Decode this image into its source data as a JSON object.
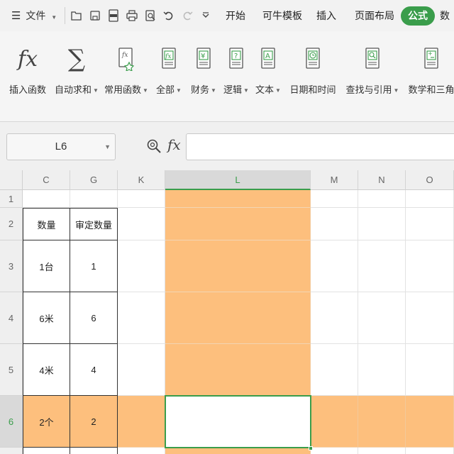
{
  "menubar": {
    "file_menu": "文件",
    "tabs": [
      "开始",
      "可牛模板",
      "插入",
      "页面布局",
      "公式",
      "数"
    ],
    "active_tab_index": 4
  },
  "ribbon": {
    "buttons": [
      {
        "label": "插入函数",
        "icon": "fx-icon",
        "dropdown": false
      },
      {
        "label": "自动求和",
        "icon": "sigma-icon",
        "dropdown": true
      },
      {
        "label": "常用函数",
        "icon": "common-function-icon",
        "dropdown": true
      },
      {
        "label": "全部",
        "icon": "all-functions-icon",
        "dropdown": true
      },
      {
        "label": "财务",
        "icon": "finance-icon",
        "dropdown": true
      },
      {
        "label": "逻辑",
        "icon": "logic-icon",
        "dropdown": true
      },
      {
        "label": "文本",
        "icon": "text-function-icon",
        "dropdown": true
      },
      {
        "label": "日期和时间",
        "icon": "datetime-icon",
        "dropdown": true
      },
      {
        "label": "查找与引用",
        "icon": "lookup-icon",
        "dropdown": true
      },
      {
        "label": "数学和三角",
        "icon": "math-icon",
        "dropdown": true
      }
    ]
  },
  "formula_bar": {
    "name_box": "L6",
    "fx_label": "fx",
    "formula": ""
  },
  "sheet": {
    "columns": [
      "C",
      "G",
      "K",
      "L",
      "M",
      "N",
      "O"
    ],
    "selected_column": "L",
    "rows": [
      "1",
      "2",
      "3",
      "4",
      "5",
      "6"
    ],
    "selected_row": "6",
    "cells": {
      "C2": "数量",
      "G2": "审定数量",
      "C3": "1台",
      "G3": "1",
      "C4": "6米",
      "G4": "6",
      "C5": "4米",
      "G5": "4",
      "C6": "2个",
      "G6": "2"
    },
    "highlight_color": "#fdbf7d",
    "accent_color": "#3a9d4b"
  }
}
